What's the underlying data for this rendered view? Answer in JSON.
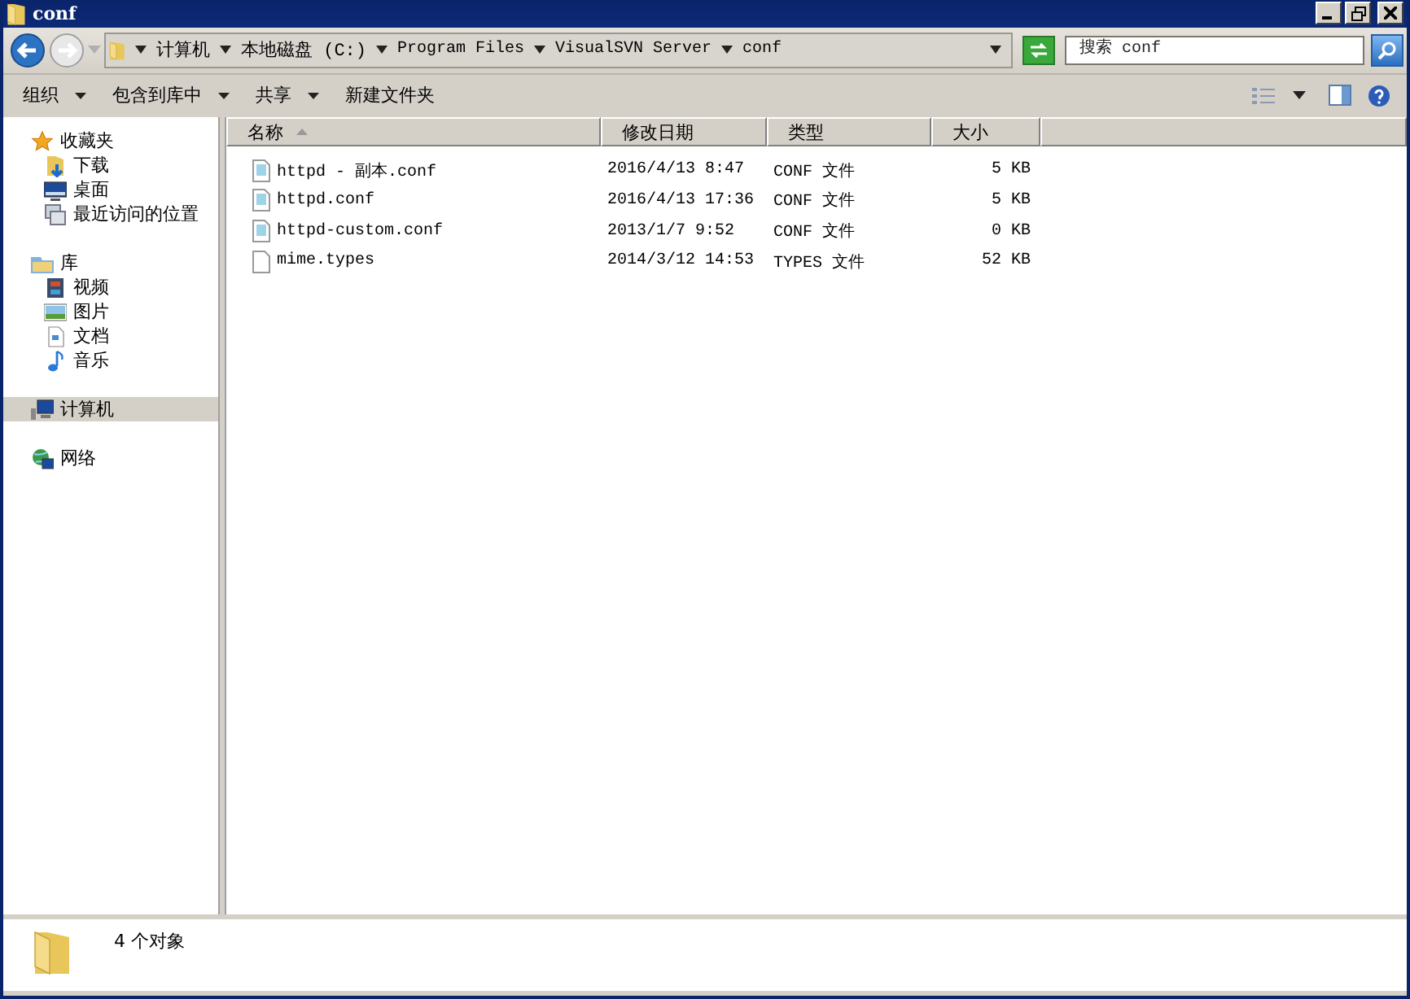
{
  "window": {
    "title": "conf"
  },
  "address": {
    "breadcrumbs": [
      "计算机",
      "本地磁盘 (C:)",
      "Program Files",
      "VisualSVN Server",
      "conf"
    ]
  },
  "search": {
    "placeholder": "搜索 conf"
  },
  "toolbar": {
    "buttons": [
      {
        "label": "组织",
        "dropdown": true
      },
      {
        "label": "包含到库中",
        "dropdown": true
      },
      {
        "label": "共享",
        "dropdown": true
      },
      {
        "label": "新建文件夹",
        "dropdown": false
      }
    ]
  },
  "sidebar": {
    "groups": [
      {
        "label": "收藏夹",
        "kind": "star",
        "selected": false,
        "children": [
          {
            "label": "下载",
            "kind": "download",
            "selected": false
          },
          {
            "label": "桌面",
            "kind": "desktop",
            "selected": false
          },
          {
            "label": "最近访问的位置",
            "kind": "recent",
            "selected": false
          }
        ]
      },
      {
        "label": "库",
        "kind": "library",
        "selected": false,
        "children": [
          {
            "label": "视频",
            "kind": "video",
            "selected": false
          },
          {
            "label": "图片",
            "kind": "image",
            "selected": false
          },
          {
            "label": "文档",
            "kind": "document",
            "selected": false
          },
          {
            "label": "音乐",
            "kind": "music",
            "selected": false
          }
        ]
      },
      {
        "label": "计算机",
        "kind": "computer",
        "selected": true
      },
      {
        "label": "网络",
        "kind": "network",
        "selected": false
      }
    ]
  },
  "table": {
    "columns": [
      {
        "label": "名称",
        "sorted": true
      },
      {
        "label": "修改日期",
        "sorted": false
      },
      {
        "label": "类型",
        "sorted": false
      },
      {
        "label": "大小",
        "sorted": false
      }
    ],
    "rows": [
      {
        "kind": "conf",
        "name": "httpd - 副本.conf",
        "modified": "2016/4/13 8:47",
        "type": "CONF 文件",
        "size": "5 KB"
      },
      {
        "kind": "conf",
        "name": "httpd.conf",
        "modified": "2016/4/13 17:36",
        "type": "CONF 文件",
        "size": "5 KB"
      },
      {
        "kind": "conf",
        "name": "httpd-custom.conf",
        "modified": "2013/1/7 9:52",
        "type": "CONF 文件",
        "size": "0 KB"
      },
      {
        "kind": "blank",
        "name": "mime.types",
        "modified": "2014/3/12 14:53",
        "type": "TYPES 文件",
        "size": "52 KB"
      }
    ]
  },
  "status_bar": {
    "text": "4 个对象"
  }
}
